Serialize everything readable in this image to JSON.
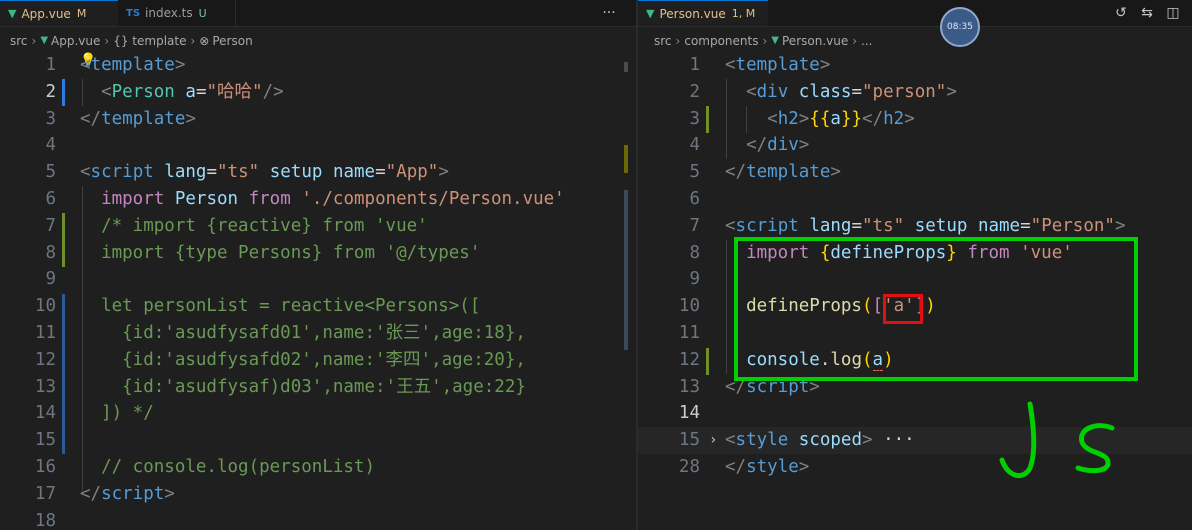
{
  "left": {
    "tabs": [
      {
        "icon": "vue-icon",
        "label": "App.vue",
        "badge": "M",
        "active": true
      },
      {
        "icon": "ts-icon",
        "icon_text": "TS",
        "label": "index.ts",
        "badge": "U",
        "active": false
      }
    ],
    "more_label": "···",
    "breadcrumb": [
      "src",
      "App.vue",
      "{} template",
      "Person"
    ],
    "lines": [
      {
        "n": "1",
        "tokens": [
          [
            "t-punc",
            "<"
          ],
          [
            "t-tag",
            "template"
          ],
          [
            "t-punc",
            ">"
          ]
        ]
      },
      {
        "n": "2",
        "current": true,
        "tokens": [
          [
            "t-txt",
            "  "
          ],
          [
            "t-punc",
            "<"
          ],
          [
            "t-cls",
            "Person"
          ],
          [
            "t-txt",
            " "
          ],
          [
            "t-attr",
            "a"
          ],
          [
            "t-eq",
            "="
          ],
          [
            "t-str",
            "\"哈哈\""
          ],
          [
            "t-punc",
            "/>"
          ]
        ]
      },
      {
        "n": "3",
        "tokens": [
          [
            "t-punc",
            "</"
          ],
          [
            "t-tag",
            "template"
          ],
          [
            "t-punc",
            ">"
          ]
        ]
      },
      {
        "n": "4",
        "tokens": []
      },
      {
        "n": "5",
        "tokens": [
          [
            "t-punc",
            "<"
          ],
          [
            "t-tag",
            "script"
          ],
          [
            "t-txt",
            " "
          ],
          [
            "t-attr",
            "lang"
          ],
          [
            "t-eq",
            "="
          ],
          [
            "t-str",
            "\"ts\""
          ],
          [
            "t-txt",
            " "
          ],
          [
            "t-attr",
            "setup"
          ],
          [
            "t-txt",
            " "
          ],
          [
            "t-attr",
            "name"
          ],
          [
            "t-eq",
            "="
          ],
          [
            "t-str",
            "\"App\""
          ],
          [
            "t-punc",
            ">"
          ]
        ]
      },
      {
        "n": "6",
        "tokens": [
          [
            "t-txt",
            "  "
          ],
          [
            "t-kw",
            "import"
          ],
          [
            "t-txt",
            " "
          ],
          [
            "t-id",
            "Person"
          ],
          [
            "t-txt",
            " "
          ],
          [
            "t-kw",
            "from"
          ],
          [
            "t-txt",
            " "
          ],
          [
            "t-str",
            "'./components/Person.vue'"
          ]
        ]
      },
      {
        "n": "7",
        "tokens": [
          [
            "t-comment",
            "  /* import {reactive} from 'vue'"
          ]
        ]
      },
      {
        "n": "8",
        "tokens": [
          [
            "t-comment",
            "  import {type Persons} from '@/types'"
          ]
        ]
      },
      {
        "n": "9",
        "tokens": []
      },
      {
        "n": "10",
        "tokens": [
          [
            "t-comment",
            "  let personList = reactive<Persons>(["
          ]
        ]
      },
      {
        "n": "11",
        "tokens": [
          [
            "t-comment",
            "    {id:'asudfysafd01',name:'张三',age:18},"
          ]
        ]
      },
      {
        "n": "12",
        "tokens": [
          [
            "t-comment",
            "    {id:'asudfysafd02',name:'李四',age:20},"
          ]
        ]
      },
      {
        "n": "13",
        "tokens": [
          [
            "t-comment",
            "    {id:'asudfysaf)d03',name:'王五',age:22}"
          ]
        ]
      },
      {
        "n": "14",
        "tokens": [
          [
            "t-comment",
            "  ]) */"
          ]
        ]
      },
      {
        "n": "15",
        "tokens": []
      },
      {
        "n": "16",
        "tokens": [
          [
            "t-comment",
            "  // console.log(personList)"
          ]
        ]
      },
      {
        "n": "17",
        "tokens": [
          [
            "t-punc",
            "</"
          ],
          [
            "t-tag",
            "script"
          ],
          [
            "t-punc",
            ">"
          ]
        ]
      },
      {
        "n": "18",
        "tokens": []
      }
    ]
  },
  "right": {
    "tabs": [
      {
        "icon": "vue-icon",
        "label": "Person.vue",
        "badge": "1, M",
        "active": true
      }
    ],
    "actions": [
      "timeline-icon",
      "compare-icon",
      "split-editor-icon"
    ],
    "breadcrumb": [
      "src",
      "components",
      "Person.vue",
      "..."
    ],
    "clock": "08:35",
    "lines": [
      {
        "n": "1",
        "tokens": [
          [
            "t-punc",
            "<"
          ],
          [
            "t-tag",
            "template"
          ],
          [
            "t-punc",
            ">"
          ]
        ]
      },
      {
        "n": "2",
        "tokens": [
          [
            "t-txt",
            "  "
          ],
          [
            "t-punc",
            "<"
          ],
          [
            "t-tag",
            "div"
          ],
          [
            "t-txt",
            " "
          ],
          [
            "t-attr",
            "class"
          ],
          [
            "t-eq",
            "="
          ],
          [
            "t-str",
            "\"person\""
          ],
          [
            "t-punc",
            ">"
          ]
        ]
      },
      {
        "n": "3",
        "tokens": [
          [
            "t-txt",
            "    "
          ],
          [
            "t-punc",
            "<"
          ],
          [
            "t-tag",
            "h2"
          ],
          [
            "t-punc",
            ">"
          ],
          [
            "t-brace",
            "{{"
          ],
          [
            "t-id",
            "a"
          ],
          [
            "t-brace",
            "}}"
          ],
          [
            "t-punc",
            "</"
          ],
          [
            "t-tag",
            "h2"
          ],
          [
            "t-punc",
            ">"
          ]
        ]
      },
      {
        "n": "4",
        "tokens": [
          [
            "t-txt",
            "  "
          ],
          [
            "t-punc",
            "</"
          ],
          [
            "t-tag",
            "div"
          ],
          [
            "t-punc",
            ">"
          ]
        ]
      },
      {
        "n": "5",
        "tokens": [
          [
            "t-punc",
            "</"
          ],
          [
            "t-tag",
            "template"
          ],
          [
            "t-punc",
            ">"
          ]
        ]
      },
      {
        "n": "6",
        "tokens": []
      },
      {
        "n": "7",
        "tokens": [
          [
            "t-punc",
            "<"
          ],
          [
            "t-tag",
            "script"
          ],
          [
            "t-txt",
            " "
          ],
          [
            "t-attr",
            "lang"
          ],
          [
            "t-eq",
            "="
          ],
          [
            "t-str",
            "\"ts\""
          ],
          [
            "t-txt",
            " "
          ],
          [
            "t-attr",
            "setup"
          ],
          [
            "t-txt",
            " "
          ],
          [
            "t-attr",
            "name"
          ],
          [
            "t-eq",
            "="
          ],
          [
            "t-str",
            "\"Person\""
          ],
          [
            "t-punc",
            ">"
          ]
        ]
      },
      {
        "n": "8",
        "tokens": [
          [
            "t-txt",
            "  "
          ],
          [
            "t-kw",
            "import"
          ],
          [
            "t-txt",
            " "
          ],
          [
            "t-brace",
            "{"
          ],
          [
            "t-id",
            "defineProps"
          ],
          [
            "t-brace",
            "}"
          ],
          [
            "t-txt",
            " "
          ],
          [
            "t-kw",
            "from"
          ],
          [
            "t-txt",
            " "
          ],
          [
            "t-str",
            "'vue'"
          ]
        ]
      },
      {
        "n": "9",
        "tokens": []
      },
      {
        "n": "10",
        "tokens": [
          [
            "t-txt",
            "  "
          ],
          [
            "t-fn",
            "defineProps"
          ],
          [
            "t-brace",
            "("
          ],
          [
            "t-kw",
            "["
          ],
          [
            "t-str",
            "'a'"
          ],
          [
            "t-kw",
            "]"
          ],
          [
            "t-brace",
            ")"
          ]
        ]
      },
      {
        "n": "11",
        "tokens": []
      },
      {
        "n": "12",
        "tokens": [
          [
            "t-txt",
            "  "
          ],
          [
            "t-id",
            "console"
          ],
          [
            "t-txt",
            "."
          ],
          [
            "t-fn",
            "log"
          ],
          [
            "t-brace",
            "("
          ],
          [
            "t-id",
            "a"
          ],
          [
            "t-brace",
            ")"
          ]
        ]
      },
      {
        "n": "13",
        "tokens": [
          [
            "t-punc",
            "</"
          ],
          [
            "t-tag",
            "script"
          ],
          [
            "t-punc",
            ">"
          ]
        ]
      },
      {
        "n": "14",
        "current": true,
        "tokens": []
      },
      {
        "n": "15",
        "fold": true,
        "hl": true,
        "tokens": [
          [
            "t-punc",
            "<"
          ],
          [
            "t-tag",
            "style"
          ],
          [
            "t-txt",
            " "
          ],
          [
            "t-attr",
            "scoped"
          ],
          [
            "t-punc",
            ">"
          ],
          [
            "t-txt",
            " ···"
          ]
        ]
      },
      {
        "n": "28",
        "tokens": [
          [
            "t-punc",
            "</"
          ],
          [
            "t-tag",
            "style"
          ],
          [
            "t-punc",
            ">"
          ]
        ]
      }
    ]
  }
}
